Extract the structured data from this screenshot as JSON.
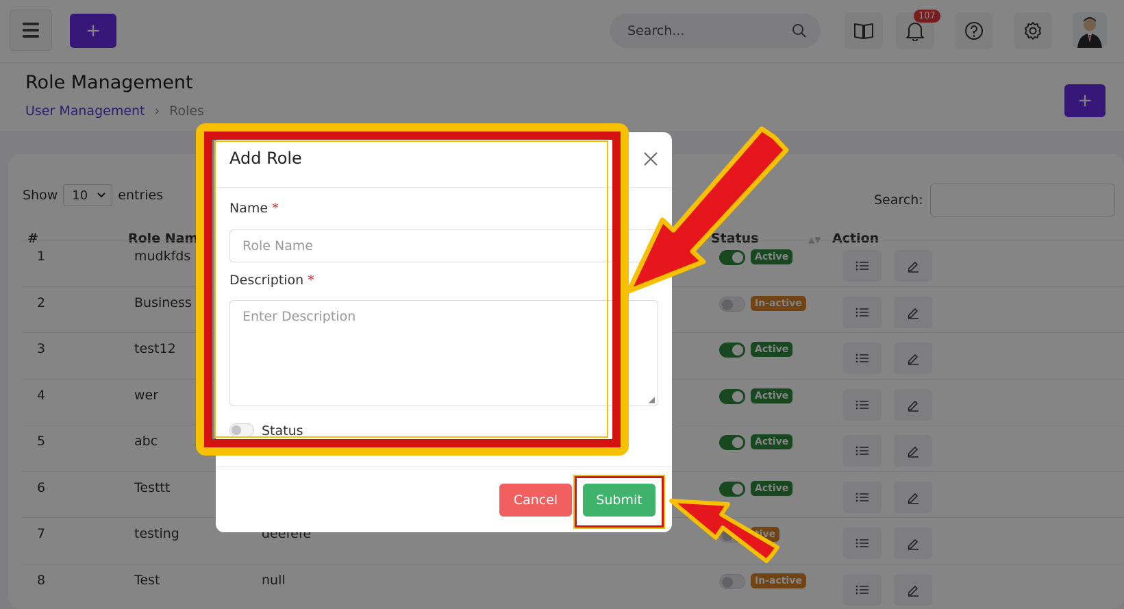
{
  "topbar": {
    "search_placeholder": "Search...",
    "notification_count": "107",
    "plus_label": "+"
  },
  "header": {
    "title": "Role Management",
    "breadcrumb": [
      "User Management",
      "›",
      "Roles"
    ],
    "plus_label": "+"
  },
  "table": {
    "show_label": "Show",
    "entries_label": "entries",
    "page_size": "10",
    "search_label": "Search:",
    "columns": [
      "#",
      "Role Nam",
      "Status",
      "Action"
    ],
    "rows": [
      {
        "num": "1",
        "name": "mudkfds",
        "desc": "",
        "active": true,
        "badge": "Active"
      },
      {
        "num": "2",
        "name": "Business A",
        "desc": "",
        "active": false,
        "badge": "In-active"
      },
      {
        "num": "3",
        "name": "test12",
        "desc": "",
        "active": true,
        "badge": "Active"
      },
      {
        "num": "4",
        "name": "wer",
        "desc": "",
        "active": true,
        "badge": "Active"
      },
      {
        "num": "5",
        "name": "abc",
        "desc": "",
        "active": true,
        "badge": "Active"
      },
      {
        "num": "6",
        "name": "Testtt",
        "desc": "",
        "active": true,
        "badge": "Active"
      },
      {
        "num": "7",
        "name": "testing",
        "desc": "deefefe",
        "active": false,
        "badge": "tive"
      },
      {
        "num": "8",
        "name": "Test",
        "desc": "null",
        "active": false,
        "badge": "In-active"
      }
    ]
  },
  "modal": {
    "title": "Add Role",
    "name_label": "Name",
    "name_placeholder": "Role Name",
    "description_label": "Description",
    "description_placeholder": "Enter Description",
    "required_mark": "*",
    "status_label": "Status",
    "cancel_label": "Cancel",
    "submit_label": "Submit"
  },
  "colors": {
    "brand": "#6a2ee8",
    "active": "#2e8b3e",
    "inactive": "#d9822b",
    "cancel": "#f25f5f",
    "submit": "#3fb36b",
    "annotation_red": "#d4120f",
    "annotation_yellow": "#f7c000"
  }
}
